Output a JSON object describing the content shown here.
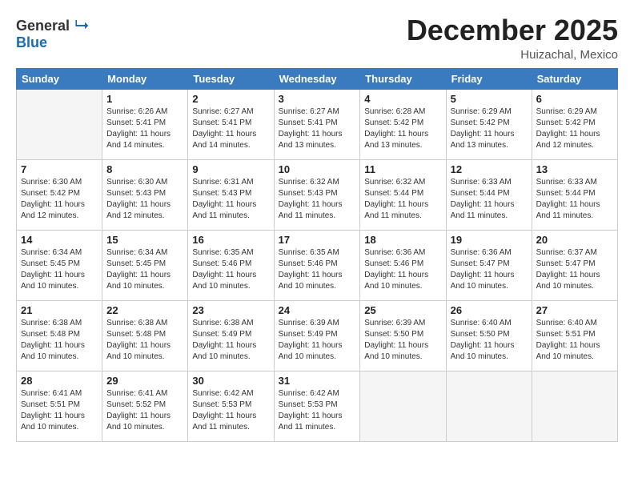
{
  "logo": {
    "general": "General",
    "blue": "Blue"
  },
  "title": "December 2025",
  "location": "Huizachal, Mexico",
  "weekdays": [
    "Sunday",
    "Monday",
    "Tuesday",
    "Wednesday",
    "Thursday",
    "Friday",
    "Saturday"
  ],
  "weeks": [
    [
      {
        "day": "",
        "sunrise": "",
        "sunset": "",
        "daylight": ""
      },
      {
        "day": "1",
        "sunrise": "Sunrise: 6:26 AM",
        "sunset": "Sunset: 5:41 PM",
        "daylight": "Daylight: 11 hours and 14 minutes."
      },
      {
        "day": "2",
        "sunrise": "Sunrise: 6:27 AM",
        "sunset": "Sunset: 5:41 PM",
        "daylight": "Daylight: 11 hours and 14 minutes."
      },
      {
        "day": "3",
        "sunrise": "Sunrise: 6:27 AM",
        "sunset": "Sunset: 5:41 PM",
        "daylight": "Daylight: 11 hours and 13 minutes."
      },
      {
        "day": "4",
        "sunrise": "Sunrise: 6:28 AM",
        "sunset": "Sunset: 5:42 PM",
        "daylight": "Daylight: 11 hours and 13 minutes."
      },
      {
        "day": "5",
        "sunrise": "Sunrise: 6:29 AM",
        "sunset": "Sunset: 5:42 PM",
        "daylight": "Daylight: 11 hours and 13 minutes."
      },
      {
        "day": "6",
        "sunrise": "Sunrise: 6:29 AM",
        "sunset": "Sunset: 5:42 PM",
        "daylight": "Daylight: 11 hours and 12 minutes."
      }
    ],
    [
      {
        "day": "7",
        "sunrise": "Sunrise: 6:30 AM",
        "sunset": "Sunset: 5:42 PM",
        "daylight": "Daylight: 11 hours and 12 minutes."
      },
      {
        "day": "8",
        "sunrise": "Sunrise: 6:30 AM",
        "sunset": "Sunset: 5:43 PM",
        "daylight": "Daylight: 11 hours and 12 minutes."
      },
      {
        "day": "9",
        "sunrise": "Sunrise: 6:31 AM",
        "sunset": "Sunset: 5:43 PM",
        "daylight": "Daylight: 11 hours and 11 minutes."
      },
      {
        "day": "10",
        "sunrise": "Sunrise: 6:32 AM",
        "sunset": "Sunset: 5:43 PM",
        "daylight": "Daylight: 11 hours and 11 minutes."
      },
      {
        "day": "11",
        "sunrise": "Sunrise: 6:32 AM",
        "sunset": "Sunset: 5:44 PM",
        "daylight": "Daylight: 11 hours and 11 minutes."
      },
      {
        "day": "12",
        "sunrise": "Sunrise: 6:33 AM",
        "sunset": "Sunset: 5:44 PM",
        "daylight": "Daylight: 11 hours and 11 minutes."
      },
      {
        "day": "13",
        "sunrise": "Sunrise: 6:33 AM",
        "sunset": "Sunset: 5:44 PM",
        "daylight": "Daylight: 11 hours and 11 minutes."
      }
    ],
    [
      {
        "day": "14",
        "sunrise": "Sunrise: 6:34 AM",
        "sunset": "Sunset: 5:45 PM",
        "daylight": "Daylight: 11 hours and 10 minutes."
      },
      {
        "day": "15",
        "sunrise": "Sunrise: 6:34 AM",
        "sunset": "Sunset: 5:45 PM",
        "daylight": "Daylight: 11 hours and 10 minutes."
      },
      {
        "day": "16",
        "sunrise": "Sunrise: 6:35 AM",
        "sunset": "Sunset: 5:46 PM",
        "daylight": "Daylight: 11 hours and 10 minutes."
      },
      {
        "day": "17",
        "sunrise": "Sunrise: 6:35 AM",
        "sunset": "Sunset: 5:46 PM",
        "daylight": "Daylight: 11 hours and 10 minutes."
      },
      {
        "day": "18",
        "sunrise": "Sunrise: 6:36 AM",
        "sunset": "Sunset: 5:46 PM",
        "daylight": "Daylight: 11 hours and 10 minutes."
      },
      {
        "day": "19",
        "sunrise": "Sunrise: 6:36 AM",
        "sunset": "Sunset: 5:47 PM",
        "daylight": "Daylight: 11 hours and 10 minutes."
      },
      {
        "day": "20",
        "sunrise": "Sunrise: 6:37 AM",
        "sunset": "Sunset: 5:47 PM",
        "daylight": "Daylight: 11 hours and 10 minutes."
      }
    ],
    [
      {
        "day": "21",
        "sunrise": "Sunrise: 6:38 AM",
        "sunset": "Sunset: 5:48 PM",
        "daylight": "Daylight: 11 hours and 10 minutes."
      },
      {
        "day": "22",
        "sunrise": "Sunrise: 6:38 AM",
        "sunset": "Sunset: 5:48 PM",
        "daylight": "Daylight: 11 hours and 10 minutes."
      },
      {
        "day": "23",
        "sunrise": "Sunrise: 6:38 AM",
        "sunset": "Sunset: 5:49 PM",
        "daylight": "Daylight: 11 hours and 10 minutes."
      },
      {
        "day": "24",
        "sunrise": "Sunrise: 6:39 AM",
        "sunset": "Sunset: 5:49 PM",
        "daylight": "Daylight: 11 hours and 10 minutes."
      },
      {
        "day": "25",
        "sunrise": "Sunrise: 6:39 AM",
        "sunset": "Sunset: 5:50 PM",
        "daylight": "Daylight: 11 hours and 10 minutes."
      },
      {
        "day": "26",
        "sunrise": "Sunrise: 6:40 AM",
        "sunset": "Sunset: 5:50 PM",
        "daylight": "Daylight: 11 hours and 10 minutes."
      },
      {
        "day": "27",
        "sunrise": "Sunrise: 6:40 AM",
        "sunset": "Sunset: 5:51 PM",
        "daylight": "Daylight: 11 hours and 10 minutes."
      }
    ],
    [
      {
        "day": "28",
        "sunrise": "Sunrise: 6:41 AM",
        "sunset": "Sunset: 5:51 PM",
        "daylight": "Daylight: 11 hours and 10 minutes."
      },
      {
        "day": "29",
        "sunrise": "Sunrise: 6:41 AM",
        "sunset": "Sunset: 5:52 PM",
        "daylight": "Daylight: 11 hours and 10 minutes."
      },
      {
        "day": "30",
        "sunrise": "Sunrise: 6:42 AM",
        "sunset": "Sunset: 5:53 PM",
        "daylight": "Daylight: 11 hours and 11 minutes."
      },
      {
        "day": "31",
        "sunrise": "Sunrise: 6:42 AM",
        "sunset": "Sunset: 5:53 PM",
        "daylight": "Daylight: 11 hours and 11 minutes."
      },
      {
        "day": "",
        "sunrise": "",
        "sunset": "",
        "daylight": ""
      },
      {
        "day": "",
        "sunrise": "",
        "sunset": "",
        "daylight": ""
      },
      {
        "day": "",
        "sunrise": "",
        "sunset": "",
        "daylight": ""
      }
    ]
  ]
}
